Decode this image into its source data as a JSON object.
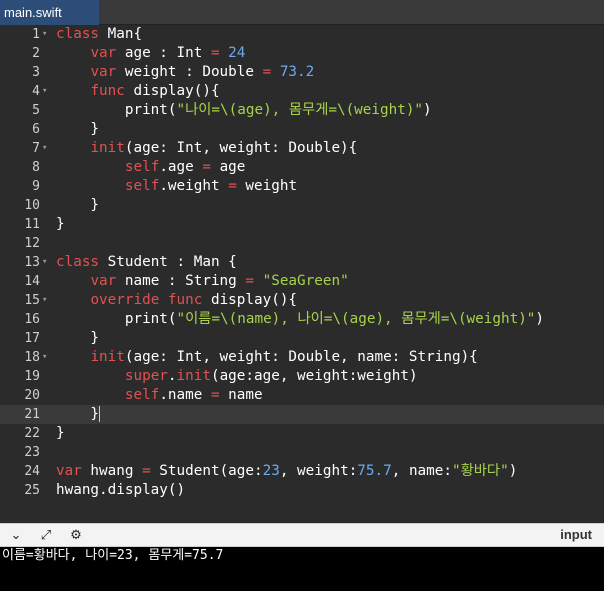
{
  "tab": {
    "label": "main.swift"
  },
  "editor": {
    "lines": [
      {
        "n": "1",
        "fold": true,
        "tokens": [
          [
            "kw",
            "class"
          ],
          [
            "fn",
            " Man{"
          ]
        ]
      },
      {
        "n": "2",
        "fold": false,
        "tokens": [
          [
            "fn",
            "    "
          ],
          [
            "kw",
            "var"
          ],
          [
            "fn",
            " age : Int "
          ],
          [
            "op",
            "="
          ],
          [
            "fn",
            " "
          ],
          [
            "num",
            "24"
          ]
        ]
      },
      {
        "n": "3",
        "fold": false,
        "tokens": [
          [
            "fn",
            "    "
          ],
          [
            "kw",
            "var"
          ],
          [
            "fn",
            " weight : Double "
          ],
          [
            "op",
            "="
          ],
          [
            "fn",
            " "
          ],
          [
            "num",
            "73.2"
          ]
        ]
      },
      {
        "n": "4",
        "fold": true,
        "tokens": [
          [
            "fn",
            "    "
          ],
          [
            "kw",
            "func"
          ],
          [
            "fn",
            " display(){"
          ]
        ]
      },
      {
        "n": "5",
        "fold": false,
        "tokens": [
          [
            "fn",
            "        print("
          ],
          [
            "str",
            "\"나이=\\(age), 몸무게=\\(weight)\""
          ],
          [
            "fn",
            ")"
          ]
        ]
      },
      {
        "n": "6",
        "fold": false,
        "tokens": [
          [
            "fn",
            "    }"
          ]
        ]
      },
      {
        "n": "7",
        "fold": true,
        "tokens": [
          [
            "fn",
            "    "
          ],
          [
            "kw",
            "init"
          ],
          [
            "fn",
            "(age: Int, weight: Double){"
          ]
        ]
      },
      {
        "n": "8",
        "fold": false,
        "tokens": [
          [
            "fn",
            "        "
          ],
          [
            "self",
            "self"
          ],
          [
            "fn",
            ".age "
          ],
          [
            "op",
            "="
          ],
          [
            "fn",
            " age"
          ]
        ]
      },
      {
        "n": "9",
        "fold": false,
        "tokens": [
          [
            "fn",
            "        "
          ],
          [
            "self",
            "self"
          ],
          [
            "fn",
            ".weight "
          ],
          [
            "op",
            "="
          ],
          [
            "fn",
            " weight"
          ]
        ]
      },
      {
        "n": "10",
        "fold": false,
        "tokens": [
          [
            "fn",
            "    }"
          ]
        ]
      },
      {
        "n": "11",
        "fold": false,
        "tokens": [
          [
            "fn",
            "}"
          ]
        ]
      },
      {
        "n": "12",
        "fold": false,
        "tokens": []
      },
      {
        "n": "13",
        "fold": true,
        "tokens": [
          [
            "kw",
            "class"
          ],
          [
            "fn",
            " Student : Man {"
          ]
        ]
      },
      {
        "n": "14",
        "fold": false,
        "tokens": [
          [
            "fn",
            "    "
          ],
          [
            "kw",
            "var"
          ],
          [
            "fn",
            " name : String "
          ],
          [
            "op",
            "="
          ],
          [
            "fn",
            " "
          ],
          [
            "str",
            "\"SeaGreen\""
          ]
        ]
      },
      {
        "n": "15",
        "fold": true,
        "tokens": [
          [
            "fn",
            "    "
          ],
          [
            "kw",
            "override"
          ],
          [
            "fn",
            " "
          ],
          [
            "kw",
            "func"
          ],
          [
            "fn",
            " display(){"
          ]
        ]
      },
      {
        "n": "16",
        "fold": false,
        "tokens": [
          [
            "fn",
            "        print("
          ],
          [
            "str",
            "\"이름=\\(name), 나이=\\(age), 몸무게=\\(weight)\""
          ],
          [
            "fn",
            ")"
          ]
        ]
      },
      {
        "n": "17",
        "fold": false,
        "tokens": [
          [
            "fn",
            "    }"
          ]
        ]
      },
      {
        "n": "18",
        "fold": true,
        "tokens": [
          [
            "fn",
            "    "
          ],
          [
            "kw",
            "init"
          ],
          [
            "fn",
            "(age: Int, weight: Double, name: String){"
          ]
        ]
      },
      {
        "n": "19",
        "fold": false,
        "tokens": [
          [
            "fn",
            "        "
          ],
          [
            "kw",
            "super"
          ],
          [
            "fn",
            "."
          ],
          [
            "kw",
            "init"
          ],
          [
            "fn",
            "(age:age, weight:weight)"
          ]
        ]
      },
      {
        "n": "20",
        "fold": false,
        "tokens": [
          [
            "fn",
            "        "
          ],
          [
            "self",
            "self"
          ],
          [
            "fn",
            ".name "
          ],
          [
            "op",
            "="
          ],
          [
            "fn",
            " name"
          ]
        ]
      },
      {
        "n": "21",
        "fold": false,
        "active": true,
        "tokens": [
          [
            "fn",
            "    }"
          ]
        ]
      },
      {
        "n": "22",
        "fold": false,
        "tokens": [
          [
            "fn",
            "}"
          ]
        ]
      },
      {
        "n": "23",
        "fold": false,
        "tokens": []
      },
      {
        "n": "24",
        "fold": false,
        "tokens": [
          [
            "kw",
            "var"
          ],
          [
            "fn",
            " hwang "
          ],
          [
            "op",
            "="
          ],
          [
            "fn",
            " Student(age:"
          ],
          [
            "num",
            "23"
          ],
          [
            "fn",
            ", weight:"
          ],
          [
            "num",
            "75.7"
          ],
          [
            "fn",
            ", name:"
          ],
          [
            "str",
            "\"황바다\""
          ],
          [
            "fn",
            ")"
          ]
        ]
      },
      {
        "n": "25",
        "fold": false,
        "tokens": [
          [
            "fn",
            "hwang.display()"
          ]
        ]
      }
    ]
  },
  "toolbar": {
    "buttons": [
      {
        "name": "collapse-icon",
        "glyph": "⌄"
      },
      {
        "name": "expand-icon",
        "glyph": "⤢"
      },
      {
        "name": "settings-icon",
        "glyph": "⚙"
      }
    ],
    "input_label": "input"
  },
  "console": {
    "output": "이름=황바다, 나이=23, 몸무게=75.7"
  },
  "colors": {
    "keyword": "#e05252",
    "number": "#6aaaf0",
    "string": "#a7d34a",
    "tab": "#2c4d77",
    "background": "#2b2b2b"
  }
}
